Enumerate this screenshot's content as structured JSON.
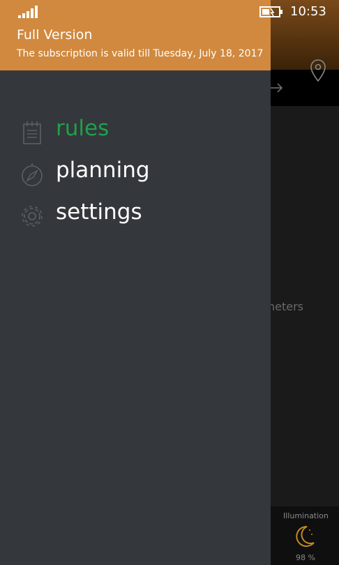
{
  "status_bar": {
    "time": "10:53"
  },
  "banner": {
    "title": "Full Version",
    "subtitle": "The subscription is valid till Tuesday, July 18, 2017"
  },
  "menu": {
    "items": [
      {
        "label": "rules",
        "icon": "notepad-icon",
        "active": true
      },
      {
        "label": "planning",
        "icon": "compass-icon",
        "active": false
      },
      {
        "label": "settings",
        "icon": "gear-icon",
        "active": false
      }
    ]
  },
  "background_app": {
    "partial_text": "neters",
    "illumination_label": "Illumination",
    "illumination_value": "98 %"
  },
  "colors": {
    "banner": "#d0893f",
    "drawer": "#34373b",
    "active_item": "#1fa04a"
  }
}
